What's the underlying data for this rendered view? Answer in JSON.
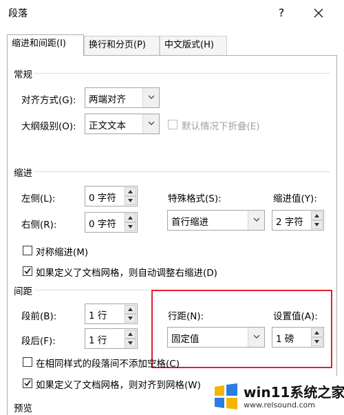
{
  "window": {
    "title": "段落",
    "help_label": "?",
    "close_icon": "close-icon"
  },
  "tabs": [
    {
      "label": "缩进和间距(I)",
      "active": true
    },
    {
      "label": "换行和分页(P)",
      "active": false
    },
    {
      "label": "中文版式(H)",
      "active": false
    }
  ],
  "general": {
    "heading": "常规",
    "alignment_label": "对齐方式(G):",
    "alignment_value": "两端对齐",
    "outline_label": "大纲级别(O):",
    "outline_value": "正文文本",
    "collapse_label": "默认情况下折叠(E)"
  },
  "indent": {
    "heading": "缩进",
    "left_label": "左侧(L):",
    "left_value": "0 字符",
    "right_label": "右侧(R):",
    "right_value": "0 字符",
    "special_label": "特殊格式(S):",
    "special_value": "首行缩进",
    "by_label": "缩进值(Y):",
    "by_value": "2 字符",
    "mirror_label": "对称缩进(M)",
    "auto_adjust_label": "如果定义了文档网格，则自动调整右缩进(D)"
  },
  "spacing": {
    "heading": "间距",
    "before_label": "段前(B):",
    "before_value": "1 行",
    "after_label": "段后(F):",
    "after_value": "1 行",
    "line_spacing_label": "行距(N):",
    "line_spacing_value": "固定值",
    "at_label": "设置值(A):",
    "at_value": "1 磅",
    "no_space_label": "在相同样式的段落间不添加空格(C)",
    "snap_grid_label": "如果定义了文档网格，则对齐到网格(W)"
  },
  "preview": {
    "heading": "预览"
  },
  "watermark": {
    "brand": "win11系统之家",
    "url": "www.relsound.com"
  },
  "colors": {
    "highlight": "#e0202a",
    "border": "#adadad"
  }
}
